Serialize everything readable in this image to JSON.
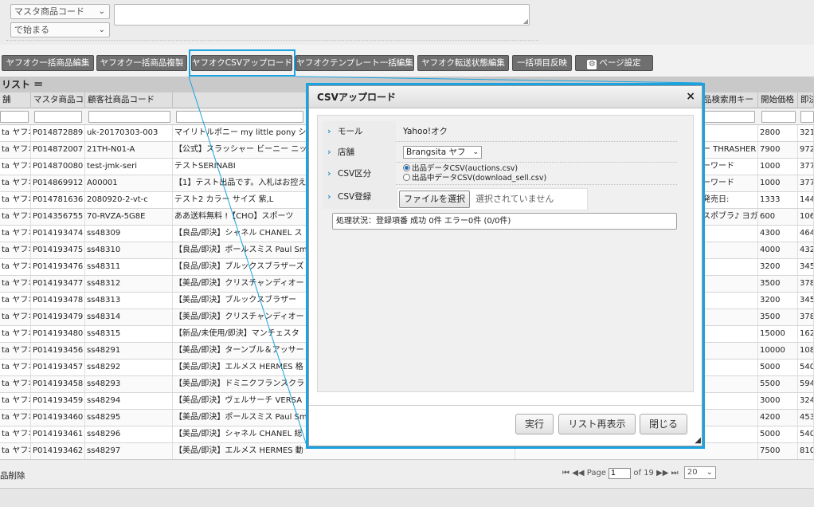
{
  "filters": {
    "field_select": "マスタ商品コード",
    "match_select": "で始まる"
  },
  "toolbar": {
    "buttons": [
      "ヤフオク一括商品編集",
      "ヤフオク一括商品複製",
      "ヤフオクCSVアップロード",
      "ヤフオクテンプレート一括編集",
      "ヤフオク転送状態編集",
      "一括項目反映",
      "ページ設定"
    ]
  },
  "list": {
    "title": "リスト ＝",
    "headers": [
      "舗",
      "マスタ商品コ",
      "顧客社商品コード",
      "",
      "品検索用キー",
      "開始価格",
      "即決"
    ],
    "rows": [
      [
        "ta ヤフオ",
        "P014872889",
        "uk-20170303-003",
        "マイリトルポニー my little pony シン",
        "",
        "2800",
        "321"
      ],
      [
        "ta ヤフオ",
        "P014872007",
        "21TH-N01-A",
        "【公式】スラッシャー ビーニー ニッ",
        "ー THRASHER",
        "7900",
        "972"
      ],
      [
        "ta ヤフオ",
        "P014870080",
        "test-jmk-seri",
        "テストSERINABI",
        "ーワード",
        "1000",
        "377"
      ],
      [
        "ta ヤフオ",
        "P014869912",
        "A00001",
        "【1】テスト出品です。入札はお控え",
        "ーワード",
        "1000",
        "377"
      ],
      [
        "ta ヤフオ",
        "P014781636",
        "2080920-2-vt-c",
        "テスト2 カラー サイズ 紫,L",
        "発売日:",
        "1333",
        "144"
      ],
      [
        "ta ヤフオ",
        "P014356755",
        "70-RVZA-5G8E",
        "ああ送料無料 !【CHO】スポーツ",
        "スポブラ♪ ヨガ",
        "600",
        "106"
      ],
      [
        "ta ヤフオ",
        "P014193474",
        "ss48309",
        "【良品/即決】シャネル CHANEL ス",
        "",
        "4300",
        "464"
      ],
      [
        "ta ヤフオ",
        "P014193475",
        "ss48310",
        "【良品/即決】ポールスミス Paul Sm",
        "",
        "4000",
        "432"
      ],
      [
        "ta ヤフオ",
        "P014193476",
        "ss48311",
        "【良品/即決】ブルックスブラザーズ",
        "",
        "3200",
        "345"
      ],
      [
        "ta ヤフオ",
        "P014193477",
        "ss48312",
        "【美品/即決】クリスチャンディオー",
        "",
        "3500",
        "378"
      ],
      [
        "ta ヤフオ",
        "P014193478",
        "ss48313",
        "【美品/即決】ブルックスブラザー",
        "",
        "3200",
        "345"
      ],
      [
        "ta ヤフオ",
        "P014193479",
        "ss48314",
        "【美品/即決】クリスチャンディオー",
        "",
        "3500",
        "378"
      ],
      [
        "ta ヤフオ",
        "P014193480",
        "ss48315",
        "【新品/未使用/即決】マンチェスタ",
        "",
        "15000",
        "162"
      ],
      [
        "ta ヤフオ",
        "P014193456",
        "ss48291",
        "【美品/即決】ターンブル＆アッサー",
        "",
        "10000",
        "108"
      ],
      [
        "ta ヤフオ",
        "P014193457",
        "ss48292",
        "【美品/即決】エルメス HERMES 格",
        "",
        "5000",
        "540"
      ],
      [
        "ta ヤフオ",
        "P014193458",
        "ss48293",
        "【美品/即決】ドミニクフランスクラ",
        "",
        "5500",
        "594"
      ],
      [
        "ta ヤフオ",
        "P014193459",
        "ss48294",
        "【美品/即決】ヴェルサーチ VERSA",
        "",
        "3000",
        "324"
      ],
      [
        "ta ヤフオ",
        "P014193460",
        "ss48295",
        "【美品/即決】ポールスミス Paul Sm",
        "",
        "4200",
        "453"
      ],
      [
        "ta ヤフオ",
        "P014193461",
        "ss48296",
        "【美品/即決】シャネル CHANEL 総",
        "",
        "5000",
        "540"
      ],
      [
        "ta ヤフオ",
        "P014193462",
        "ss48297",
        "【美品/即決】エルメス HERMES 動",
        "",
        "7500",
        "810"
      ]
    ],
    "footer_delete": "品削除",
    "pager": {
      "page_label": "Page",
      "page_value": "1",
      "of_label": "of 19",
      "per_page": "20"
    }
  },
  "dialog": {
    "title": "CSVアップロード",
    "close": "×",
    "fields": {
      "mall_label": "モール",
      "mall_value": "Yahoo!オク",
      "store_label": "店舗",
      "store_value": "Brangsita ヤフ",
      "csv_type_label": "CSV区分",
      "csv_type_option1": "出品データCSV(auctions.csv)",
      "csv_type_option2": "出品中データCSV(download_sell.csv)",
      "csv_register_label": "CSV登録",
      "file_button": "ファイルを選択",
      "file_status": "選択されていません"
    },
    "status": "処理状況：登録項番 成功 0件 エラー0件 (0/0件)",
    "buttons": {
      "run": "実行",
      "refresh": "リスト再表示",
      "close": "閉じる"
    }
  },
  "colors": {
    "highlight": "#1aa3e0",
    "toolbar_button": "#6f6f6f"
  }
}
